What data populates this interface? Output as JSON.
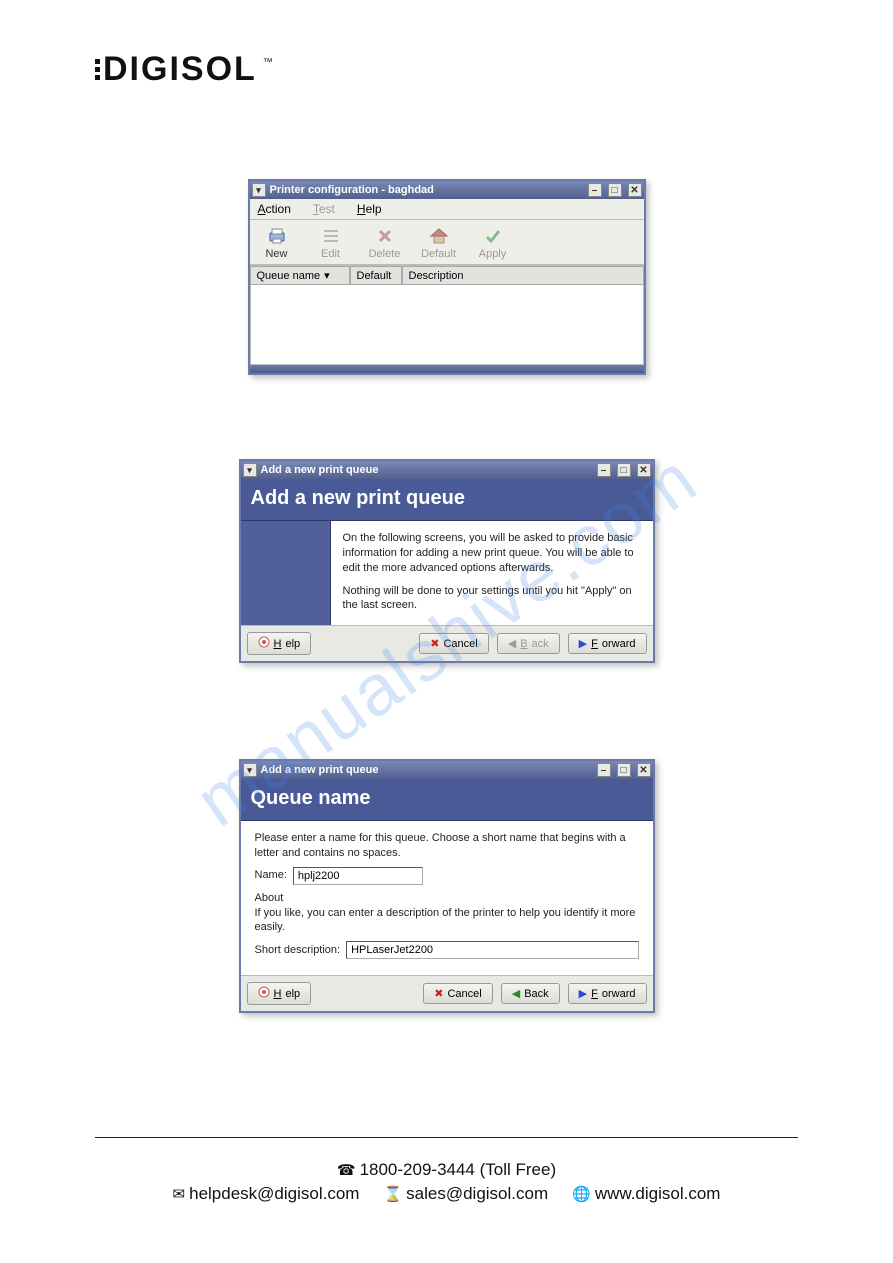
{
  "brand": "DIGISOL",
  "watermark": "manualshive.com",
  "win1": {
    "title": "Printer configuration - baghdad",
    "menu": {
      "action": "Action",
      "test": "Test",
      "help": "Help"
    },
    "tools": {
      "new": "New",
      "edit": "Edit",
      "delete": "Delete",
      "default": "Default",
      "apply": "Apply"
    },
    "cols": {
      "queue": "Queue name",
      "default": "Default",
      "desc": "Description"
    }
  },
  "win2": {
    "title": "Add a new print queue",
    "heading": "Add a new print queue",
    "p1": "On the following screens, you will be asked to provide basic information for adding a new print queue.  You will be able to edit the more advanced options afterwards.",
    "p2": "Nothing will be done to your settings until you hit \"Apply\" on the last screen.",
    "btn": {
      "help": "Help",
      "cancel": "Cancel",
      "back": "Back",
      "forward": "Forward"
    }
  },
  "win3": {
    "title": "Add a new print queue",
    "heading": "Queue name",
    "intro": "Please enter a name for this queue.  Choose a short name that begins with a letter and contains no spaces.",
    "name_label": "Name:",
    "name_value": "hplj2200",
    "about_label": "About",
    "about_text": "If you like, you can enter a description of the printer to help you identify it more easily.",
    "desc_label": "Short description:",
    "desc_value": "HPLaserJet2200",
    "btn": {
      "help": "Help",
      "cancel": "Cancel",
      "back": "Back",
      "forward": "Forward"
    }
  },
  "footer": {
    "phone": "1800-209-3444 (Toll Free)",
    "helpdesk": "helpdesk@digisol.com",
    "sales": "sales@digisol.com",
    "web": "www.digisol.com"
  }
}
